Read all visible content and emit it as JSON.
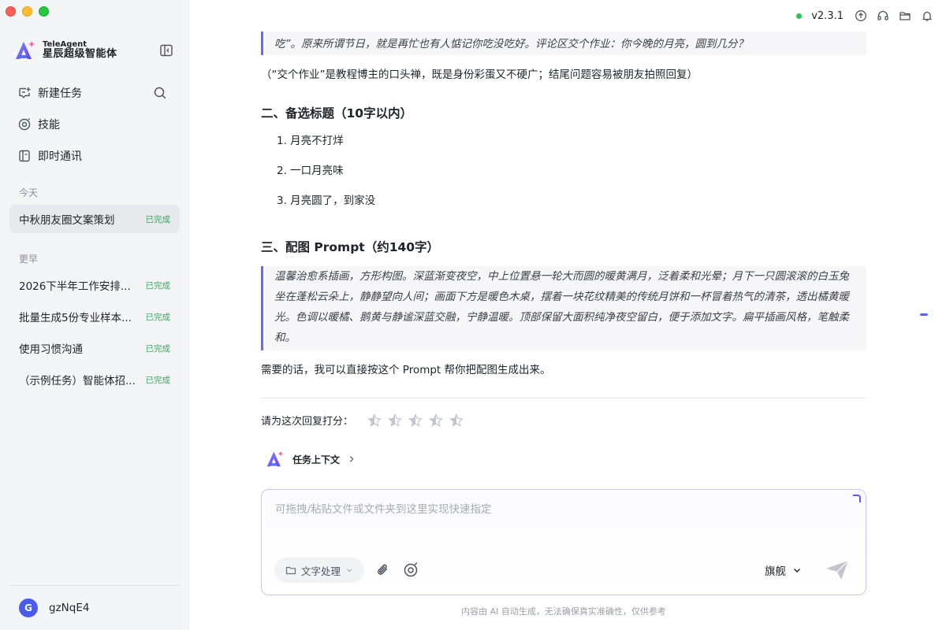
{
  "app": {
    "brand_en": "TeleAgent",
    "brand_cn": "星辰超级智能体"
  },
  "nav": {
    "items": [
      {
        "label": "新建任务"
      },
      {
        "label": "技能"
      },
      {
        "label": "即时通讯"
      }
    ]
  },
  "sidebar": {
    "today_label": "今天",
    "earlier_label": "更早",
    "today_tasks": [
      {
        "title": "中秋朋友圈文案策划",
        "status": "已完成"
      }
    ],
    "earlier_tasks": [
      {
        "title": "2026下半年工作安排...",
        "status": "已完成"
      },
      {
        "title": "批量生成5份专业样本...",
        "status": "已完成"
      },
      {
        "title": "使用习惯沟通",
        "status": "已完成"
      },
      {
        "title": "（示例任务）智能体招...",
        "status": "已完成"
      }
    ]
  },
  "user": {
    "initial": "G",
    "name": "gzNqE4"
  },
  "topbar": {
    "version": "v2.3.1"
  },
  "message": {
    "quote_tail": "吃”。原来所谓节日，就是再忙也有人惦记你吃没吃好。评论区交个作业：你今晚的月亮，圆到几分？",
    "note": "（“交个作业”是教程博主的口头禅，既是身份彩蛋又不硬广；结尾问题容易被朋友拍照回复）",
    "section2_title": "二、备选标题（10字以内）",
    "titles": [
      "1. 月亮不打烊",
      "2. 一口月亮味",
      "3. 月亮圆了，到家没"
    ],
    "section3_title": "三、配图 Prompt（约140字）",
    "prompt_text": "温馨治愈系插画，方形构图。深蓝渐变夜空，中上位置悬一轮大而圆的暖黄满月，泛着柔和光晕；月下一只圆滚滚的白玉兔坐在蓬松云朵上，静静望向人间；画面下方是暖色木桌，摆着一块花纹精美的传统月饼和一杯冒着热气的清茶，透出橘黄暖光。色调以暖橘、鹅黄与静谧深蓝交融，宁静温暖。顶部保留大面积纯净夜空留白，便于添加文字。扁平插画风格，笔触柔和。",
    "closing": "需要的话，我可以直接按这个 Prompt 帮你把配图生成出来。"
  },
  "rating": {
    "label": "请为这次回复打分："
  },
  "context": {
    "label": "任务上下文"
  },
  "composer": {
    "placeholder": "可拖拽/粘贴文件或文件夹到这里实现快速指定",
    "tool_chip": "文字处理",
    "model": "旗舰"
  },
  "footer": {
    "disclaimer": "内容由 AI 自动生成，无法确保真实准确性，仅供参考"
  },
  "colors": {
    "accent": "#5f5ae8",
    "status_done": "#3aa661",
    "online": "#2fbf5a"
  }
}
